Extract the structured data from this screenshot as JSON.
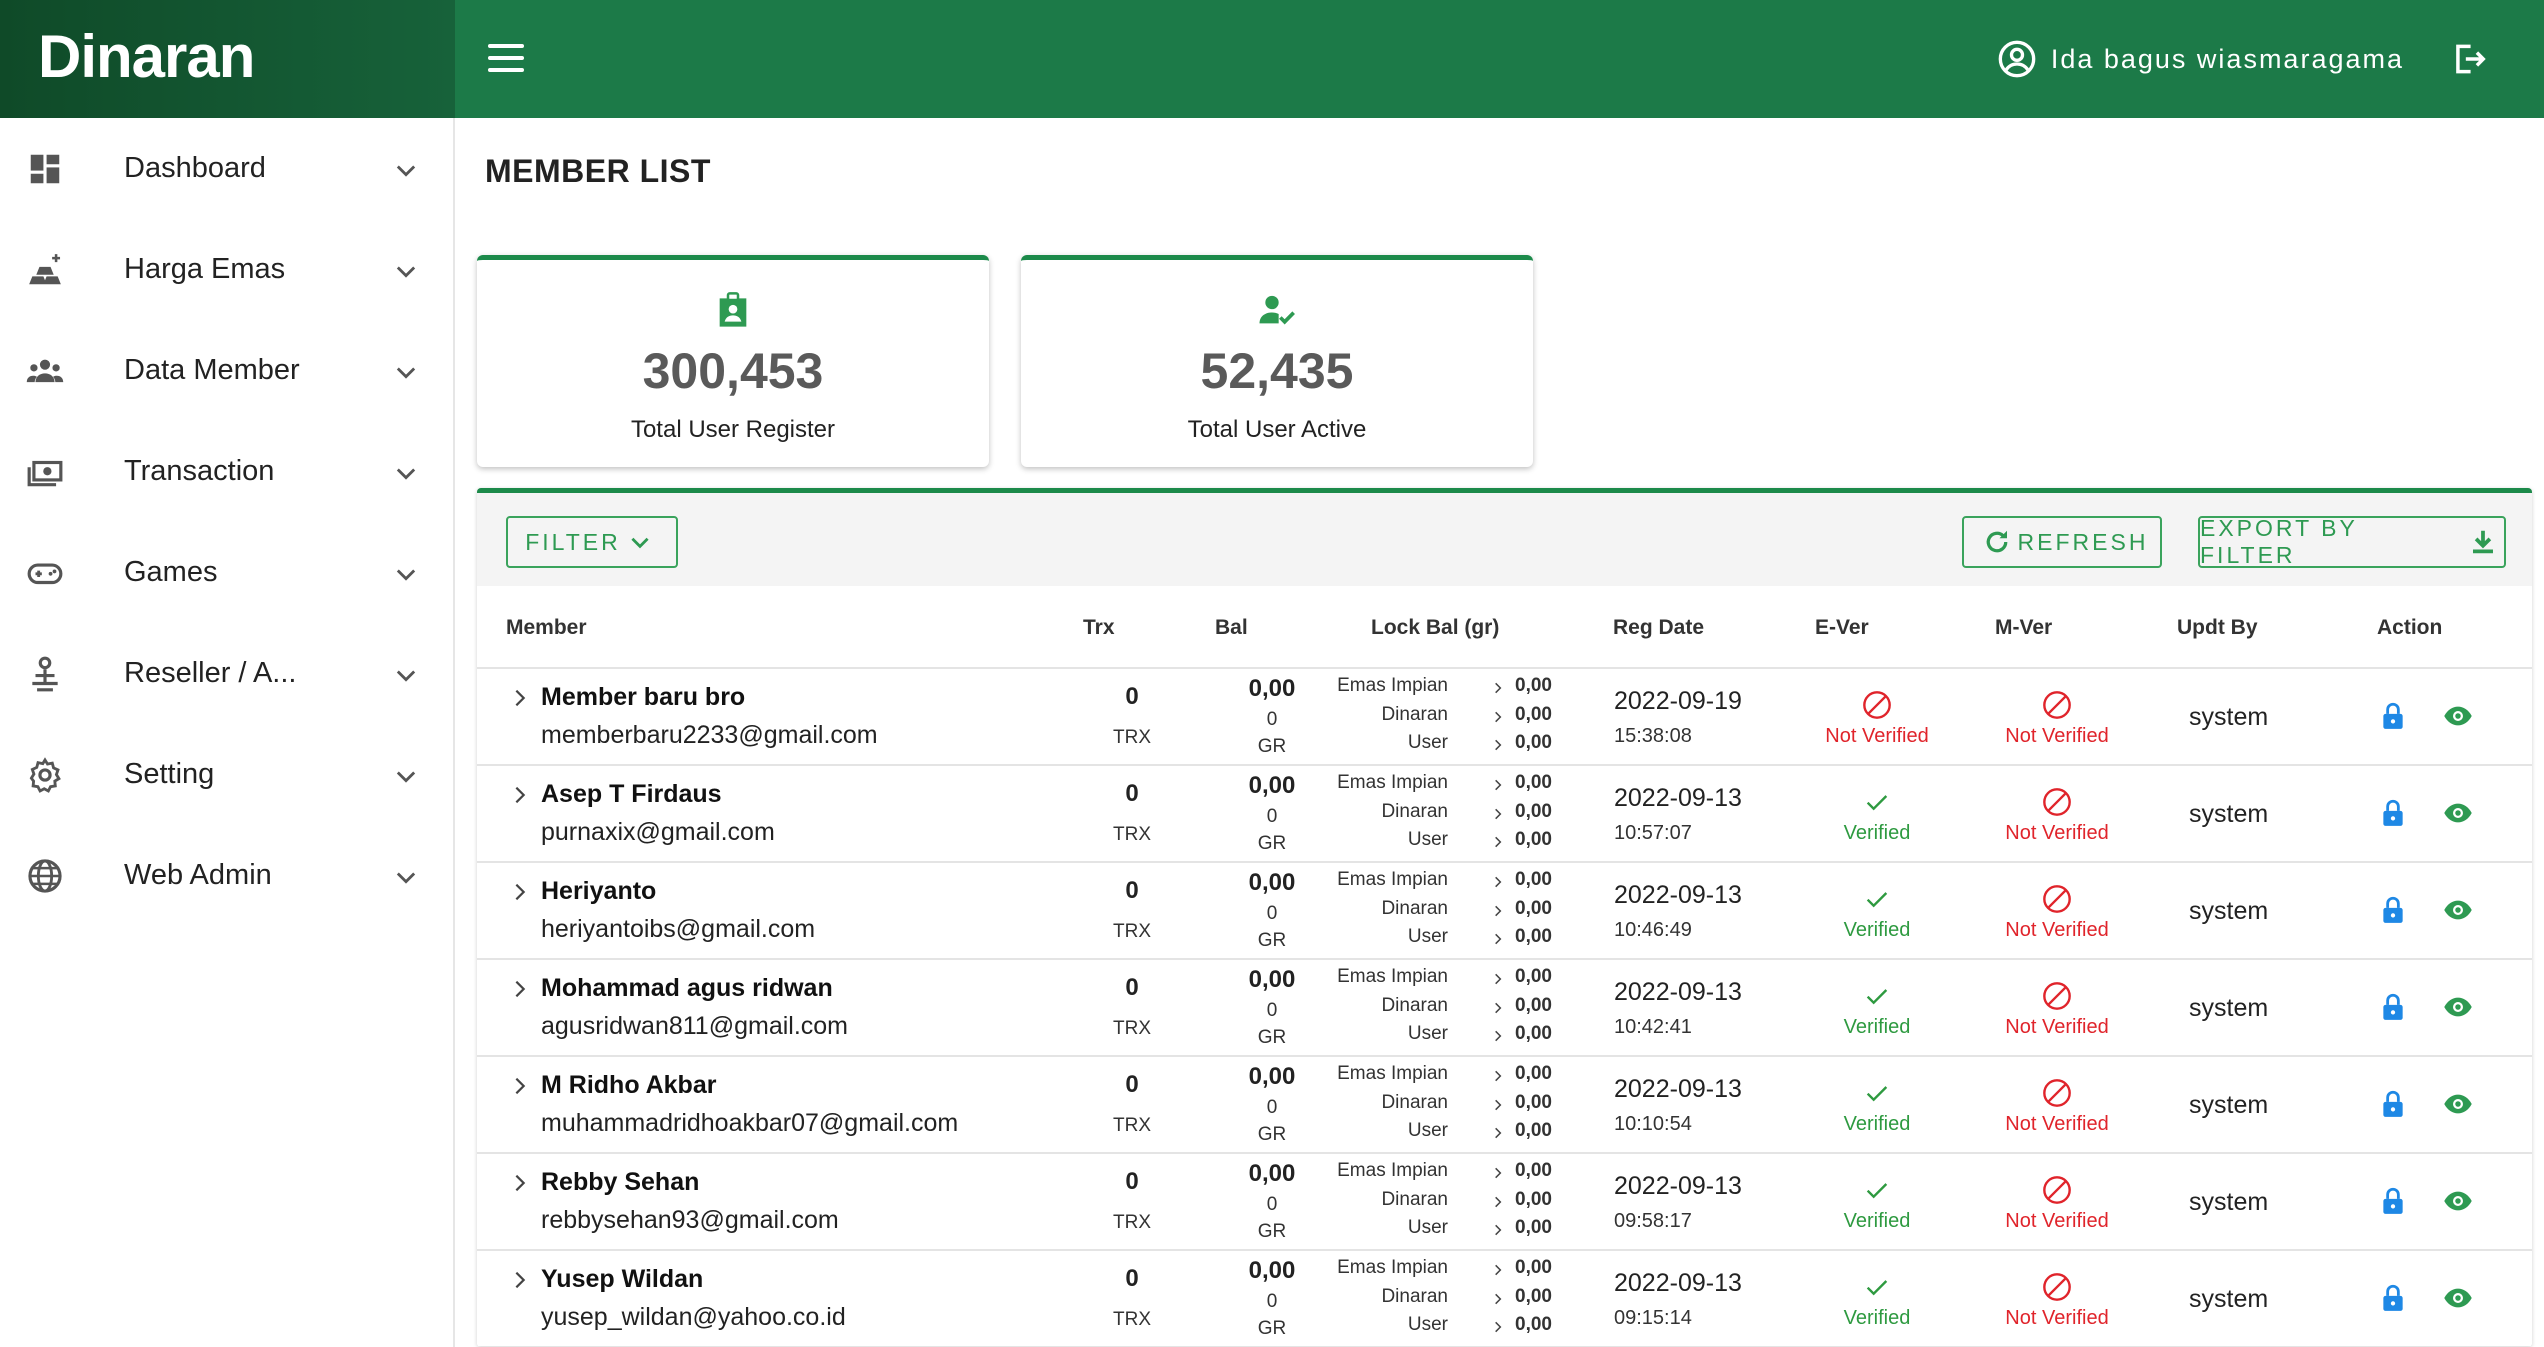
{
  "app": {
    "brand": "Dinaran",
    "user_name": "Ida bagus wiasmaragama"
  },
  "sidebar": {
    "items": [
      {
        "label": "Dashboard",
        "icon": "dashboard-icon"
      },
      {
        "label": "Harga Emas",
        "icon": "gold-bars-icon"
      },
      {
        "label": "Data Member",
        "icon": "group-icon"
      },
      {
        "label": "Transaction",
        "icon": "money-icon"
      },
      {
        "label": "Games",
        "icon": "gamepad-icon"
      },
      {
        "label": "Reseller / A...",
        "icon": "reseller-icon"
      },
      {
        "label": "Setting",
        "icon": "gear-icon"
      },
      {
        "label": "Web Admin",
        "icon": "globe-icon"
      }
    ]
  },
  "page": {
    "title": "MEMBER LIST"
  },
  "stats": [
    {
      "value": "300,453",
      "label": "Total User Register",
      "icon": "badge-icon"
    },
    {
      "value": "52,435",
      "label": "Total User Active",
      "icon": "user-check-icon"
    }
  ],
  "toolbar": {
    "filter_label": "FILTER",
    "refresh_label": "REFRESH",
    "export_label": "EXPORT BY FILTER"
  },
  "table": {
    "headers": {
      "member": "Member",
      "trx": "Trx",
      "bal": "Bal",
      "lock_bal": "Lock Bal (gr)",
      "reg_date": "Reg Date",
      "e_ver": "E-Ver",
      "m_ver": "M-Ver",
      "updt_by": "Updt By",
      "action": "Action"
    },
    "units": {
      "trx": "TRX",
      "gr": "GR"
    },
    "lock_labels": [
      "Emas Impian",
      "Dinaran",
      "User"
    ],
    "status_labels": {
      "verified": "Verified",
      "not_verified": "Not Verified"
    },
    "rows": [
      {
        "name": "Member baru bro",
        "email": "memberbaru2233@gmail.com",
        "trx": "0",
        "bal": "0,00",
        "bal_sub": "0",
        "lock": [
          "0,00",
          "0,00",
          "0,00"
        ],
        "reg_date": "2022-09-19",
        "reg_time": "15:38:08",
        "e_ver": "not_verified",
        "m_ver": "not_verified",
        "updt_by": "system"
      },
      {
        "name": "Asep T Firdaus",
        "email": "purnaxix@gmail.com",
        "trx": "0",
        "bal": "0,00",
        "bal_sub": "0",
        "lock": [
          "0,00",
          "0,00",
          "0,00"
        ],
        "reg_date": "2022-09-13",
        "reg_time": "10:57:07",
        "e_ver": "verified",
        "m_ver": "not_verified",
        "updt_by": "system"
      },
      {
        "name": "Heriyanto",
        "email": "heriyantoibs@gmail.com",
        "trx": "0",
        "bal": "0,00",
        "bal_sub": "0",
        "lock": [
          "0,00",
          "0,00",
          "0,00"
        ],
        "reg_date": "2022-09-13",
        "reg_time": "10:46:49",
        "e_ver": "verified",
        "m_ver": "not_verified",
        "updt_by": "system"
      },
      {
        "name": "Mohammad agus ridwan",
        "email": "agusridwan811@gmail.com",
        "trx": "0",
        "bal": "0,00",
        "bal_sub": "0",
        "lock": [
          "0,00",
          "0,00",
          "0,00"
        ],
        "reg_date": "2022-09-13",
        "reg_time": "10:42:41",
        "e_ver": "verified",
        "m_ver": "not_verified",
        "updt_by": "system"
      },
      {
        "name": "M Ridho Akbar",
        "email": "muhammadridhoakbar07@gmail.com",
        "trx": "0",
        "bal": "0,00",
        "bal_sub": "0",
        "lock": [
          "0,00",
          "0,00",
          "0,00"
        ],
        "reg_date": "2022-09-13",
        "reg_time": "10:10:54",
        "e_ver": "verified",
        "m_ver": "not_verified",
        "updt_by": "system"
      },
      {
        "name": "Rebby Sehan",
        "email": "rebbysehan93@gmail.com",
        "trx": "0",
        "bal": "0,00",
        "bal_sub": "0",
        "lock": [
          "0,00",
          "0,00",
          "0,00"
        ],
        "reg_date": "2022-09-13",
        "reg_time": "09:58:17",
        "e_ver": "verified",
        "m_ver": "not_verified",
        "updt_by": "system"
      },
      {
        "name": "Yusep Wildan",
        "email": "yusep_wildan@yahoo.co.id",
        "trx": "0",
        "bal": "0,00",
        "bal_sub": "0",
        "lock": [
          "0,00",
          "0,00",
          "0,00"
        ],
        "reg_date": "2022-09-13",
        "reg_time": "09:15:14",
        "e_ver": "verified",
        "m_ver": "not_verified",
        "updt_by": "system"
      }
    ]
  },
  "colors": {
    "header_green": "#1c7a48",
    "accent_green": "#2e9a52",
    "error_red": "#e0242b",
    "lock_blue": "#1e88e5"
  }
}
